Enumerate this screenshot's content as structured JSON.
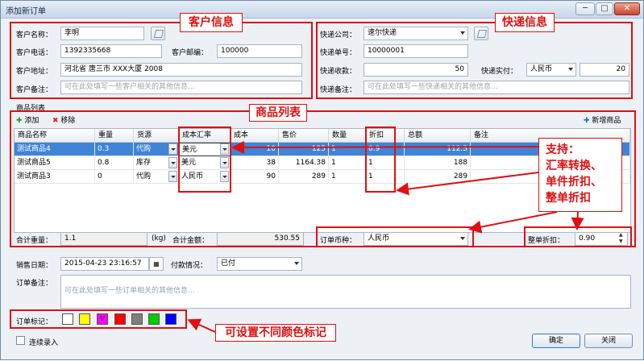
{
  "window": {
    "title": "添加新订单"
  },
  "customer": {
    "section_tag": "客户信息",
    "name_label": "客户名称：",
    "name_value": "李明",
    "phone_label": "客户电话：",
    "phone_value": "1392335668",
    "zip_label": "客户邮编：",
    "zip_value": "100000",
    "addr_label": "客户地址：",
    "addr_value": "河北省 唐三市 XXX大厦 2008",
    "note_label": "客户备注：",
    "note_placeholder": "可在此处填写一些客户相关的其他信息..."
  },
  "express": {
    "section_tag": "快递信息",
    "company_label": "快递公司：",
    "company_value": "速尔快递",
    "number_label": "快递单号：",
    "number_value": "10000001",
    "fee_label": "快递收款：",
    "fee_value": "50",
    "actual_label": "快递实付：",
    "currency_value": "人民币",
    "actual_value": "20",
    "note_label": "快递备注：",
    "note_placeholder": "可在此处填写一些快递相关的其他信息..."
  },
  "products": {
    "group_label": "商品列表",
    "section_tag": "商品列表",
    "add_label": "添加",
    "remove_label": "移除",
    "new_label": "新增商品",
    "headers": [
      "商品名称",
      "重量",
      "货源",
      "成本汇率",
      "成本",
      "售价",
      "数量",
      "折扣",
      "总额",
      "备注"
    ],
    "rows": [
      {
        "name": "测试商品4",
        "weight": "0.3",
        "source": "代购",
        "rate": "美元",
        "cost": "10",
        "price": "125",
        "qty": "1",
        "discount": "0.9",
        "total": "112.5",
        "note": ""
      },
      {
        "name": "测试商品5",
        "weight": "0.8",
        "source": "库存",
        "rate": "美元",
        "cost": "38",
        "price": "1164.38",
        "qty": "1",
        "discount": "1",
        "total": "188",
        "note": ""
      },
      {
        "name": "测试商品3",
        "weight": "0",
        "source": "代购",
        "rate": "人民币",
        "cost": "90",
        "price": "289",
        "qty": "1",
        "discount": "1",
        "total": "289",
        "note": ""
      }
    ]
  },
  "summary": {
    "weight_label": "合计重量：",
    "weight_value": "1.1",
    "weight_unit": "(kg)",
    "amount_label": "合计金额：",
    "amount_value": "530.55",
    "currency_label": "订单币种：",
    "currency_value": "人民币",
    "discount_label": "整单折扣：",
    "discount_value": "0.90"
  },
  "order": {
    "date_label": "销售日期：",
    "date_value": "2015-04-23 23:16:57",
    "pay_label": "付款情况：",
    "pay_value": "已付",
    "note_label": "订单备注：",
    "note_placeholder": "可在此处填写一些订单相关的其他信息...",
    "mark_label": "订单标记：",
    "mark_colors": [
      "#ffffff",
      "#ffff00",
      "#ff00ff",
      "#ff0000",
      "#808080",
      "#00cc00",
      "#0000ff"
    ],
    "selected_mark_glyph": "V",
    "continuous_label": "连续录入"
  },
  "buttons": {
    "ok": "确定",
    "close": "关闭"
  },
  "annotations": {
    "support": [
      "支持：",
      "汇率转换、",
      "单件折扣、",
      "整单折扣"
    ],
    "color_mark": "可设置不同颜色标记"
  }
}
